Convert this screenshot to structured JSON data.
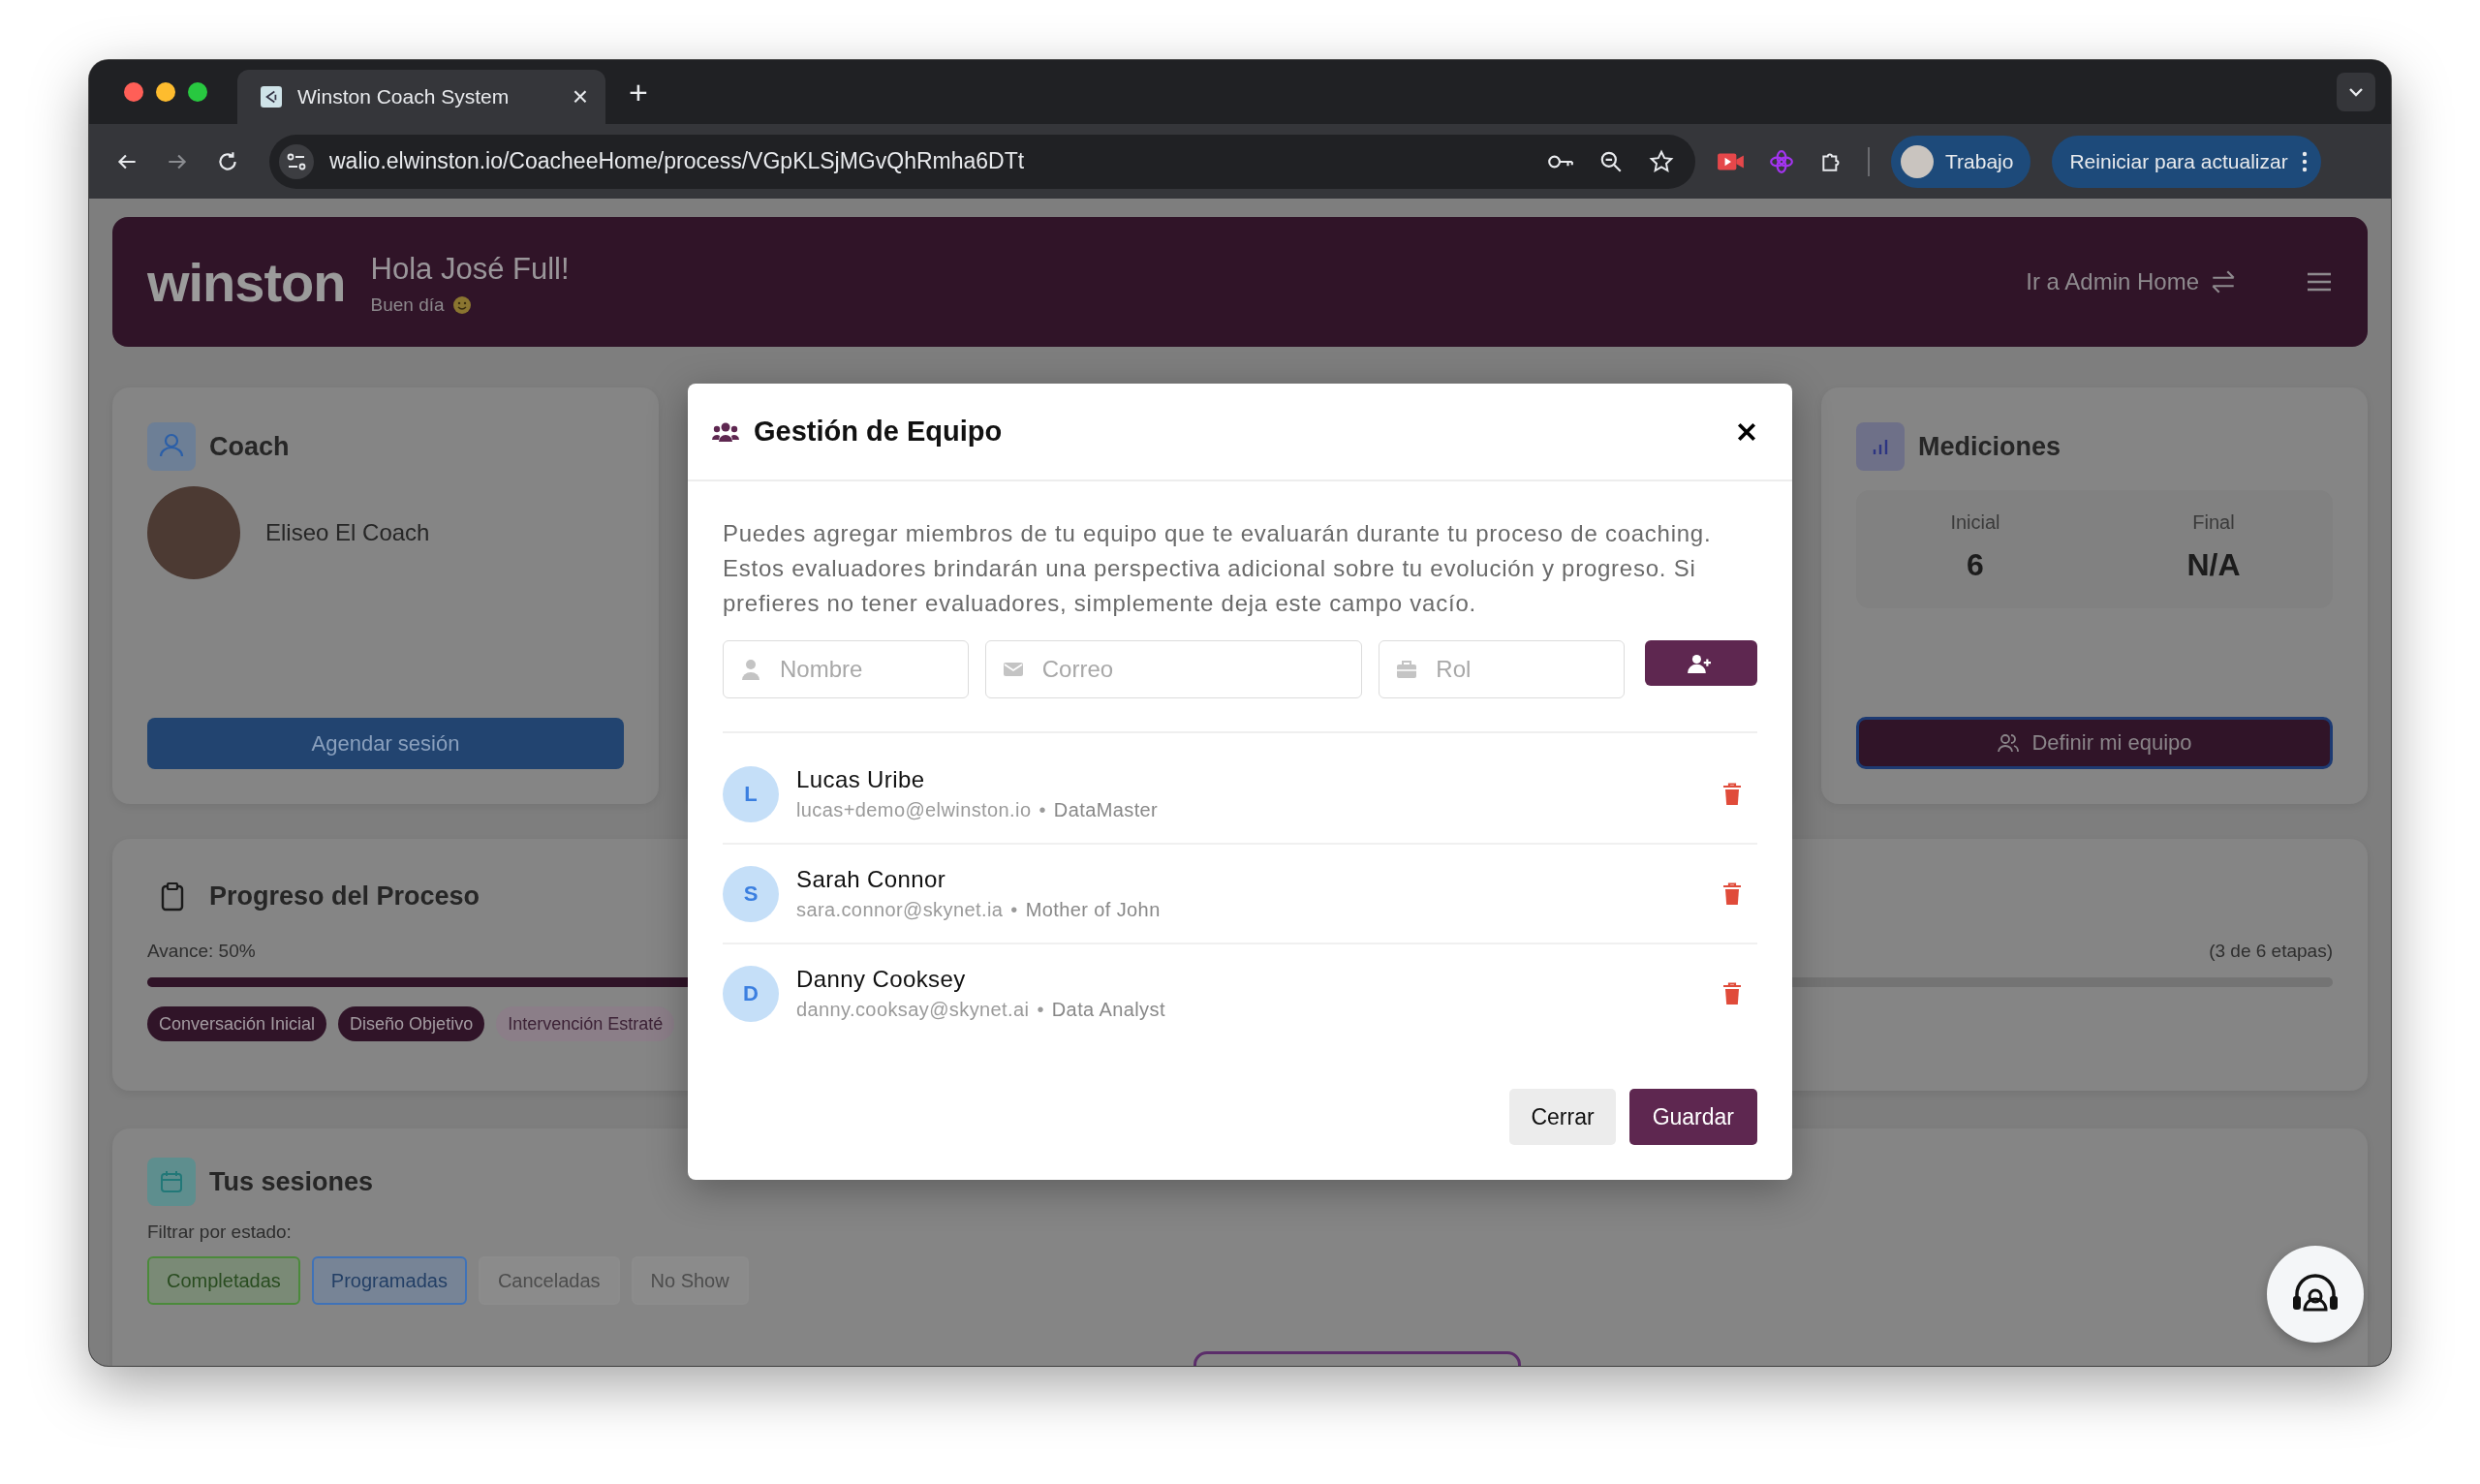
{
  "browser": {
    "tab": {
      "title": "Winston Coach System",
      "close": "×"
    },
    "new_tab": "+",
    "url": "walio.elwinston.io/CoacheeHome/process/VGpKLSjMGvQhRmha6DTt",
    "profile": "Trabajo",
    "update_button": "Reiniciar para actualizar"
  },
  "header": {
    "logo": "winston",
    "greeting": "Hola José Full!",
    "subtitle": "Buen día",
    "admin_link": "Ir a Admin Home"
  },
  "coach_card": {
    "title": "Coach",
    "name": "Eliseo El Coach",
    "button": "Agendar sesión"
  },
  "measurements_card": {
    "title": "Mediciones",
    "stats": [
      {
        "label": "Inicial",
        "value": "6"
      },
      {
        "label": "Final",
        "value": "N/A"
      }
    ],
    "button": "Definir mi equipo"
  },
  "progress_card": {
    "title": "Progreso del Proceso",
    "progress_label": "Avance: 50%",
    "level": 0.5,
    "stages_count": "(3 de 6 etapas)",
    "stages": [
      {
        "label": "Conversación Inicial",
        "completed": true
      },
      {
        "label": "Diseño Objetivo",
        "completed": true
      },
      {
        "label": "Intervención Estraté",
        "completed": false
      }
    ]
  },
  "sessions_card": {
    "title": "Tus sesiones",
    "filter_label": "Filtrar por estado:",
    "filters": [
      {
        "label": "Completadas",
        "color": "#4b8a3b"
      },
      {
        "label": "Programadas",
        "color": "#3f72b8"
      },
      {
        "label": "Canceladas",
        "color": "#8c8c8c"
      },
      {
        "label": "No Show",
        "color": "#8c8c8c"
      }
    ]
  },
  "modal": {
    "title": "Gestión de Equipo",
    "description": "Puedes agregar miembros de tu equipo que te evaluarán durante tu proceso de coaching. Estos evaluadores brindarán una perspectiva adicional sobre tu evolución y progreso. Si prefieres no tener evaluadores, simplemente deja este campo vacío.",
    "fields": [
      {
        "kind": "name",
        "placeholder": "Nombre"
      },
      {
        "kind": "email",
        "placeholder": "Correo"
      },
      {
        "kind": "role",
        "placeholder": "Rol"
      }
    ],
    "members": [
      {
        "initial": "L",
        "name": "Lucas Uribe",
        "email": "lucas+demo@elwinston.io",
        "separator": "•",
        "role": "DataMaster"
      },
      {
        "initial": "S",
        "name": "Sarah Connor",
        "email": "sara.connor@skynet.ia",
        "separator": "•",
        "role": "Mother of John"
      },
      {
        "initial": "D",
        "name": "Danny Cooksey",
        "email": "danny.cooksay@skynet.ai",
        "separator": "•",
        "role": "Data Analyst"
      }
    ],
    "close_button": "Cerrar",
    "save_button": "Guardar"
  }
}
